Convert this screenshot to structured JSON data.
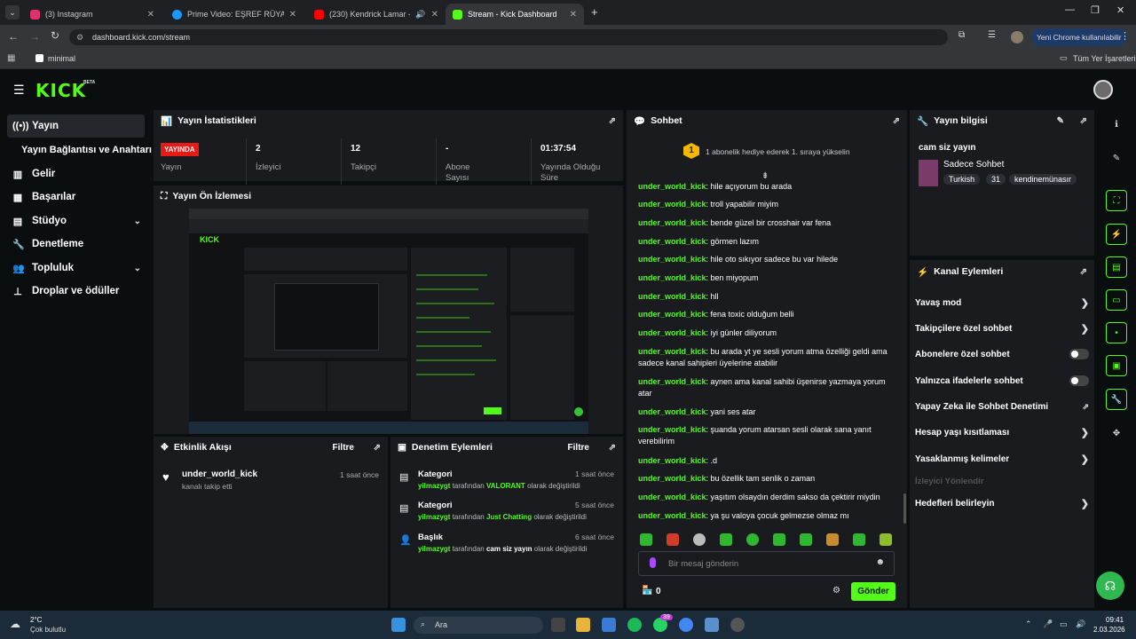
{
  "browser": {
    "tabs": [
      {
        "title": "(3) Instagram",
        "color": "#e1306c"
      },
      {
        "title": "Prime Video: EŞREF RÜYA - 2.se",
        "color": "#1a98ff"
      },
      {
        "title": "(230) Kendrick Lamar - N95",
        "color": "#ff0000"
      },
      {
        "title": "Stream - Kick Dashboard",
        "color": "#53fc18"
      }
    ],
    "url": "dashboard.kick.com/stream",
    "profile_button": "Yeni Chrome kullanılabilir",
    "bookmark": "minimal",
    "all_bookmarks": "Tüm Yer İşaretleri"
  },
  "kick": {
    "logo": "KICK",
    "beta": "BETA",
    "accent": "#53fc18"
  },
  "sidebar": {
    "items": [
      {
        "label": "Yayın",
        "icon": "broadcast-icon"
      },
      {
        "label": "Yayın Bağlantısı ve Anahtarı",
        "icon": ""
      },
      {
        "label": "Gelir",
        "icon": "revenue-icon"
      },
      {
        "label": "Başarılar",
        "icon": "achievements-icon"
      },
      {
        "label": "Stüdyo",
        "icon": "studio-icon"
      },
      {
        "label": "Denetleme",
        "icon": "wrench-icon"
      },
      {
        "label": "Topluluk",
        "icon": "community-icon"
      },
      {
        "label": "Droplar ve ödüller",
        "icon": "drops-icon"
      }
    ]
  },
  "stats": {
    "title": "Yayın İstatistikleri",
    "live_badge": "YAYINDA",
    "items": [
      {
        "value": "",
        "label": "Yayın"
      },
      {
        "value": "2",
        "label": "İzleyici"
      },
      {
        "value": "12",
        "label": "Takipçi"
      },
      {
        "value": "-",
        "label": "Abone Sayısı"
      },
      {
        "value": "01:37:54",
        "label": "Yayında Olduğu Süre"
      }
    ]
  },
  "preview": {
    "title": "Yayın Ön İzlemesi"
  },
  "activity": {
    "title": "Etkinlik Akışı",
    "filter": "Filtre",
    "events": [
      {
        "user": "under_world_kick",
        "text": "kanalı takip etti",
        "time": "1 saat önce"
      }
    ]
  },
  "moderation": {
    "title": "Denetim Eylemleri",
    "filter": "Filtre",
    "events": [
      {
        "kind": "Kategori",
        "user": "yilmazygt",
        "mid": "tarafından",
        "value": "VALORANT",
        "tail": "olarak değiştirildi",
        "time": "1 saat önce"
      },
      {
        "kind": "Kategori",
        "user": "yilmazygt",
        "mid": "tarafından",
        "value": "Just Chatting",
        "tail": "olarak değiştirildi",
        "time": "5 saat önce"
      },
      {
        "kind": "Başlık",
        "user": "yilmazygt",
        "mid": "tarafından",
        "value": "cam siz yayın",
        "tail": "olarak değiştirildi",
        "time": "6 saat önce"
      }
    ]
  },
  "chat": {
    "title": "Sohbet",
    "gift_rank": "1",
    "gift_text": "1 abonelik hediye ederek 1. sıraya yükselin",
    "messages": [
      {
        "user": "under_world_kick",
        "text": ": hile açıyorum bu arada"
      },
      {
        "user": "under_world_kick",
        "text": ": troll yapabilir miyim"
      },
      {
        "user": "under_world_kick",
        "text": ": bende güzel bir crosshair var fena"
      },
      {
        "user": "under_world_kick",
        "text": ": görmen lazım"
      },
      {
        "user": "under_world_kick",
        "text": ": hile oto sıkıyor sadece bu var hilede"
      },
      {
        "user": "under_world_kick",
        "text": ": ben miyopum"
      },
      {
        "user": "under_world_kick",
        "text": ": hll"
      },
      {
        "user": "under_world_kick",
        "text": ": fena toxic olduğum belli"
      },
      {
        "user": "under_world_kick",
        "text": ": iyi günler diliyorum"
      },
      {
        "user": "under_world_kick",
        "text": ": bu arada yt ye sesli yorum atma özelliği geldi ama sadece kanal sahipleri üyelerine atabilir"
      },
      {
        "user": "under_world_kick",
        "text": ": aynen ama kanal sahibi üşenirse yazmaya yorum atar"
      },
      {
        "user": "under_world_kick",
        "text": ": yani ses atar"
      },
      {
        "user": "under_world_kick",
        "text": ": şuanda yorum atarsan sesli olarak sana yanıt verebilirim"
      },
      {
        "user": "under_world_kick",
        "text": ": .d"
      },
      {
        "user": "under_world_kick",
        "text": ": bu özellik tam senlik o zaman"
      },
      {
        "user": "under_world_kick",
        "text": ": yaşıtım olsaydın derdim sakso da çektirir miydin"
      },
      {
        "user": "under_world_kick",
        "text": ": ya şu valoya çocuk gelmezse olmaz mı"
      }
    ],
    "placeholder": "Bir mesaj gönderin",
    "points": "0",
    "send": "Gönder"
  },
  "info": {
    "title": "Yayın bilgisi",
    "stream_title": "cam siz yayın",
    "category": "Sadece Sohbet",
    "tags": [
      "Turkish",
      "31",
      "kendinemünasır"
    ]
  },
  "channel_actions": {
    "title": "Kanal Eylemleri",
    "items": [
      {
        "label": "Yavaş mod",
        "kind": "arrow"
      },
      {
        "label": "Takipçilere özel sohbet",
        "kind": "arrow"
      },
      {
        "label": "Abonelere özel sohbet",
        "kind": "toggle"
      },
      {
        "label": "Yalnızca ifadelerle sohbet",
        "kind": "toggle"
      },
      {
        "label": "Yapay Zeka ile Sohbet Denetimi",
        "kind": "external"
      },
      {
        "label": "Hesap yaşı kısıtlaması",
        "kind": "arrow"
      },
      {
        "label": "Yasaklanmış kelimeler",
        "kind": "arrow"
      },
      {
        "label": "İzleyici Yönlendir",
        "kind": "disabled"
      },
      {
        "label": "Hedefleri belirleyin",
        "kind": "arrow"
      }
    ]
  },
  "taskbar": {
    "weather_temp": "2°C",
    "weather_desc": "Çok bulutlu",
    "search": "Ara",
    "badge": "39",
    "time": "09:41",
    "date": "2.03.2026"
  }
}
